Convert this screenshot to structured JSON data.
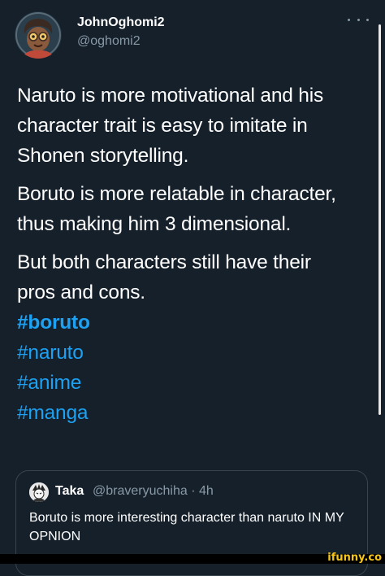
{
  "author": {
    "display_name": "JohnOghomi2",
    "handle": "@oghomi2",
    "avatar_icon": "cartoon-avatar-icon"
  },
  "menu": {
    "more_icon": "more-dots-icon"
  },
  "tweet": {
    "paragraphs": [
      "Naruto is more motivational and his character trait is easy to imitate in Shonen storytelling.",
      "Boruto is more relatable in character, thus making him 3 dimensional.",
      "But both characters still have their pros and cons."
    ],
    "lines": [
      "Naruto is more motivational and his",
      "character trait is easy to imitate in",
      "Shonen storytelling.",
      "Boruto is more relatable in character,",
      "thus making him 3 dimensional.",
      "But both characters still have their",
      "pros and cons."
    ],
    "hashtags": [
      "#boruto",
      "#naruto",
      "#anime",
      "#manga"
    ]
  },
  "quote": {
    "author_name": "Taka",
    "meta": "@braveryuchiha · 4h",
    "avatar_icon": "sketch-avatar-icon",
    "text": "Boruto is more interesting character than naruto IN MY OPNION"
  },
  "watermark": "ifunny.co",
  "colors": {
    "background": "#15202b",
    "text": "#ffffff",
    "secondary_text": "#8899a6",
    "link": "#1da1f2",
    "border": "#38444d",
    "watermark": "#f5c518"
  }
}
